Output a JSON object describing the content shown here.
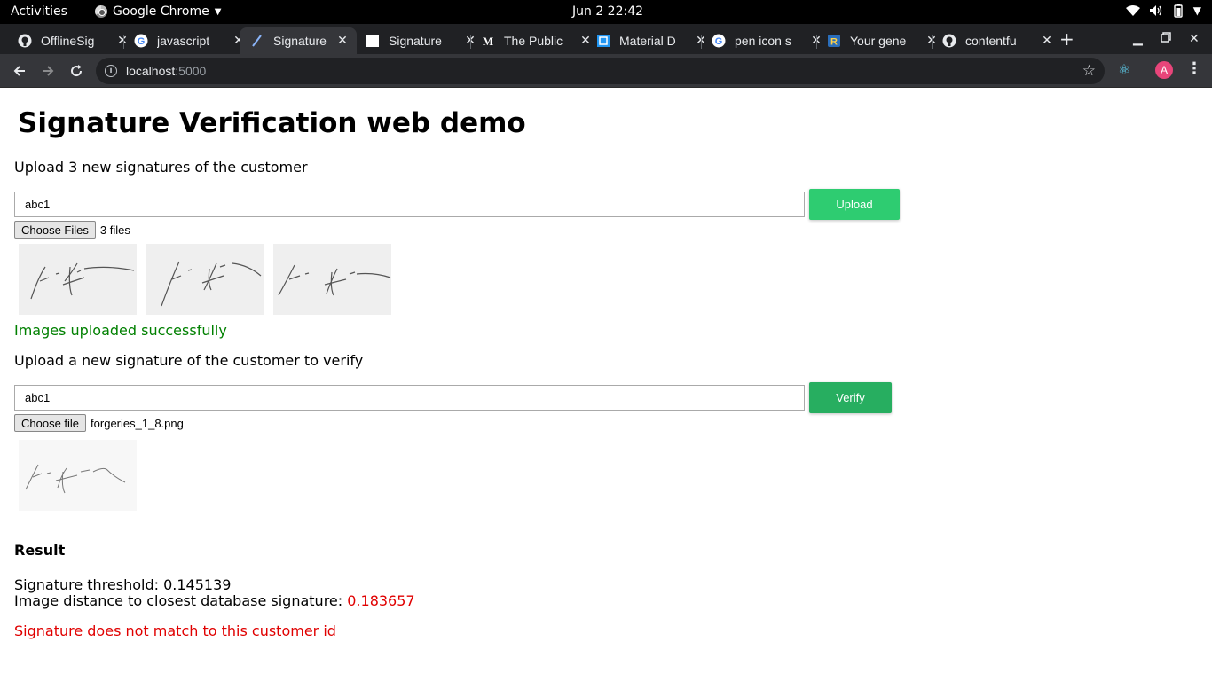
{
  "system_bar": {
    "activities": "Activities",
    "app_name": "Google Chrome",
    "clock": "Jun 2  22:42"
  },
  "tabs": [
    {
      "title": "OfflineSig",
      "icon": "github-icon"
    },
    {
      "title": "javascript",
      "icon": "google-icon"
    },
    {
      "title": "Signature",
      "icon": "pen-icon",
      "active": true
    },
    {
      "title": "Signature",
      "icon": "blank-page-icon"
    },
    {
      "title": "The Public",
      "icon": "medium-icon"
    },
    {
      "title": "Material D",
      "icon": "material-icon"
    },
    {
      "title": "pen icon s",
      "icon": "google-icon"
    },
    {
      "title": "Your gene",
      "icon": "r-icon"
    },
    {
      "title": "contentfu",
      "icon": "github-icon"
    }
  ],
  "toolbar": {
    "url_host": "localhost",
    "url_port": ":5000",
    "profile_initial": "A"
  },
  "page": {
    "heading": "Signature Verification web demo",
    "upload_section": {
      "label": "Upload 3 new signatures of the customer",
      "customer_id": "abc1",
      "button": "Upload",
      "file_button": "Choose Files",
      "file_status": "3 files",
      "success_message": "Images uploaded successfully"
    },
    "verify_section": {
      "label": "Upload a new signature of the customer to verify",
      "customer_id": "abc1",
      "button": "Verify",
      "file_button": "Choose file",
      "file_status": "forgeries_1_8.png"
    },
    "result": {
      "heading": "Result",
      "threshold_label": "Signature threshold: ",
      "threshold_value": "0.145139",
      "distance_label": "Image distance to closest database signature: ",
      "distance_value": "0.183657",
      "verdict": "Signature does not match to this customer id"
    }
  },
  "colors": {
    "accent_green": "#2ecc71",
    "success_text": "#008000",
    "error_text": "#e00000"
  }
}
